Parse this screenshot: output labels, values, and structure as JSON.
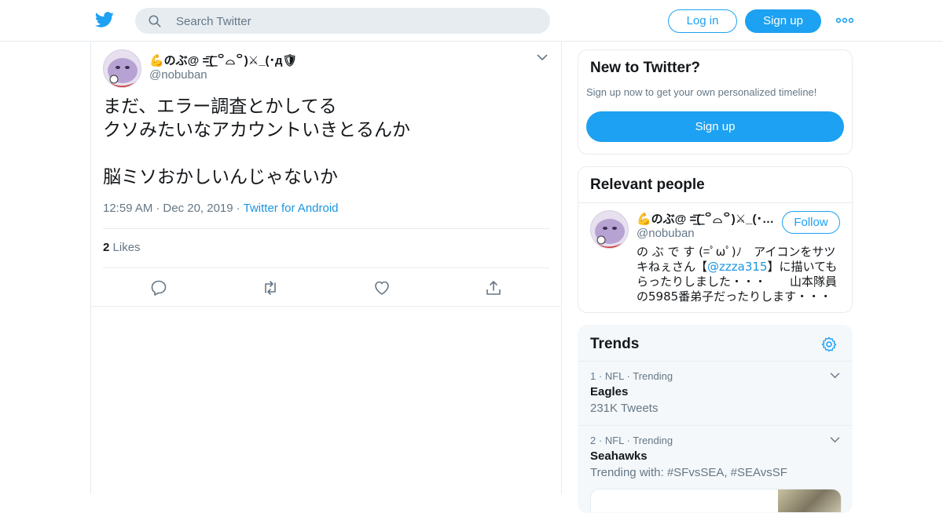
{
  "colors": {
    "accent": "#1da1f2",
    "text": "#14171a",
    "secondary": "#657786",
    "border": "#e6ecf0",
    "link": "#1b95e0"
  },
  "header": {
    "logo_icon": "twitter-bird-icon",
    "search_placeholder": "Search Twitter",
    "login_label": "Log in",
    "signup_label": "Sign up"
  },
  "tweet": {
    "display_name": "💪のぶ@ =͟͟͞͞( ꒪⌓꒪)⚔_(･д🛡",
    "handle": "@nobuban",
    "text": "まだ、エラー調査とかしてる\nクソみたいなアカウントいきとるんか\n\n脳ミソおかしいんじゃないか",
    "time": "12:59 AM",
    "date": "Dec 20, 2019",
    "source": "Twitter for Android",
    "meta_dot": "·",
    "likes_count": "2",
    "likes_label": "Likes"
  },
  "sidebar": {
    "new_to_twitter": {
      "title": "New to Twitter?",
      "subtitle": "Sign up now to get your own personalized timeline!",
      "signup_label": "Sign up"
    },
    "relevant_people": {
      "title": "Relevant people",
      "person": {
        "display_name": "💪のぶ@ =͟͟͞͞( ꒪⌓꒪)⚔_(･д🛡",
        "handle": "@nobuban",
        "follow_label": "Follow",
        "bio_before": "の ぶ で す (=ﾟωﾟ)ﾉ　アイコンをサツキねぇさん【",
        "bio_mention": "@zzza315",
        "bio_after": "】に描いてもらったりしました・・・　　山本隊員の5985番弟子だったりします・・・"
      }
    },
    "trends": {
      "title": "Trends",
      "items": [
        {
          "rank": "1",
          "category": "NFL",
          "status": "Trending",
          "name": "Eagles",
          "count": "231K Tweets"
        },
        {
          "rank": "2",
          "category": "NFL",
          "status": "Trending",
          "name": "Seahawks",
          "count": "Trending with: #SFvsSEA, #SEAvsSF"
        }
      ]
    }
  }
}
